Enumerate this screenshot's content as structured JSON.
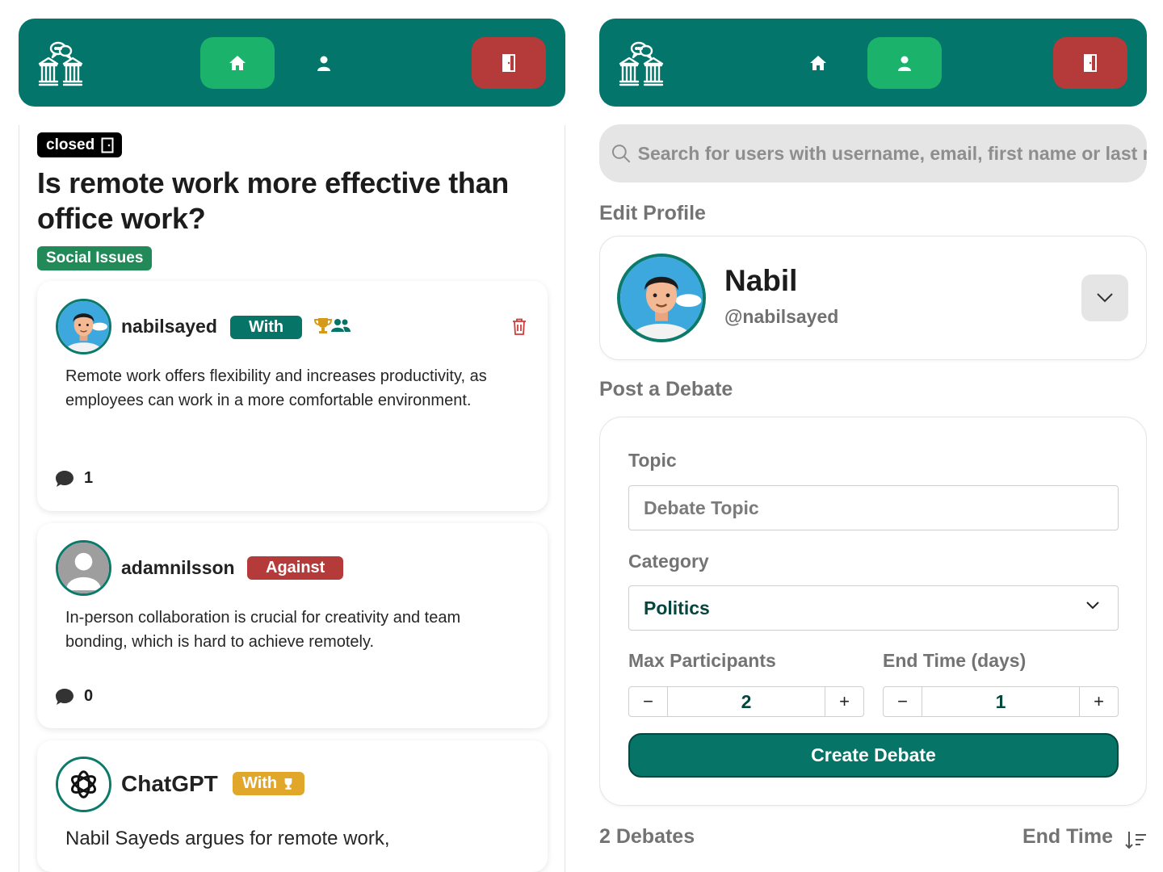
{
  "left": {
    "nav": {
      "logo_icon": "courthouse-debate-icon",
      "home_icon": "home-icon",
      "profile_icon": "user-icon",
      "logout_icon": "door-exit-icon",
      "active": "home"
    },
    "debate": {
      "status": "closed",
      "title": "Is remote work more effective than office work?",
      "category": "Social Issues",
      "arguments": [
        {
          "username": "nabilsayed",
          "stance": "With",
          "badges": [
            "trophy-icon",
            "group-icon"
          ],
          "text": "Remote work offers flexibility and increases productivity, as employees can work in a more comfortable environment.",
          "comments": "1"
        },
        {
          "username": "adamnilsson",
          "stance": "Against",
          "text": "In-person collaboration is crucial for creativity and team bonding, which is hard to achieve remotely.",
          "comments": "0"
        },
        {
          "username": "ChatGPT",
          "stance": "With",
          "text": "Nabil Sayeds argues for remote work,"
        }
      ]
    }
  },
  "right": {
    "nav": {
      "active": "profile"
    },
    "search": {
      "placeholder": "Search for users with username, email, first name or last name"
    },
    "edit_profile": {
      "heading": "Edit Profile",
      "name": "Nabil",
      "handle": "@nabilsayed"
    },
    "post_debate": {
      "heading": "Post a Debate",
      "topic_label": "Topic",
      "topic_placeholder": "Debate Topic",
      "category_label": "Category",
      "category_value": "Politics",
      "max_label": "Max Participants",
      "max_value": "2",
      "end_label": "End Time (days)",
      "end_value": "1",
      "minus": "−",
      "plus": "+",
      "submit": "Create Debate"
    },
    "list": {
      "count": "2 Debates",
      "sort_label": "End Time"
    }
  },
  "colors": {
    "brand_teal": "#03756a",
    "active_green": "#1bb36c",
    "danger_red": "#b53a3a",
    "ai_gold": "#e0a72a",
    "category_green": "#218a58"
  }
}
